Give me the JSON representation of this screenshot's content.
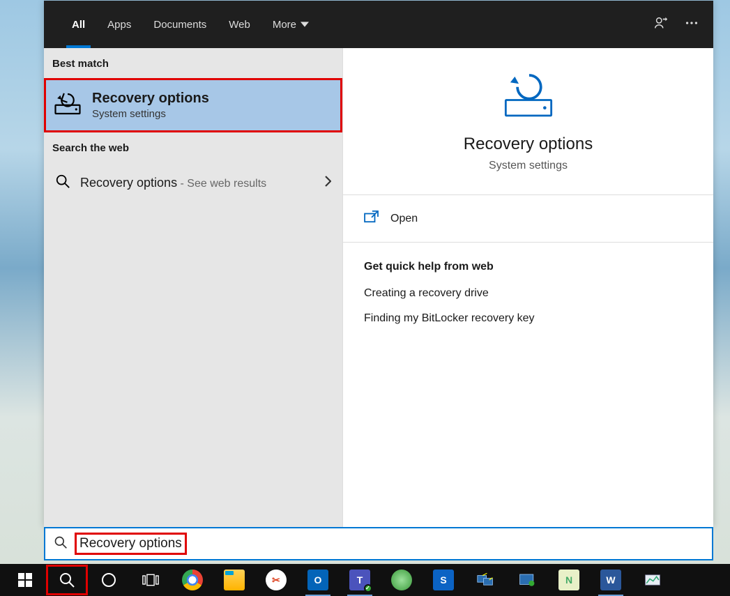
{
  "tabs": {
    "all": "All",
    "apps": "Apps",
    "documents": "Documents",
    "web": "Web",
    "more": "More"
  },
  "left": {
    "best_match_header": "Best match",
    "best_match_title": "Recovery options",
    "best_match_sub": "System settings",
    "search_web_header": "Search the web",
    "web_query": "Recovery options",
    "web_suffix": " - See web results"
  },
  "right": {
    "hero_title": "Recovery options",
    "hero_sub": "System settings",
    "open_label": "Open",
    "quick_help_header": "Get quick help from web",
    "links": {
      "0": "Creating a recovery drive",
      "1": "Finding my BitLocker recovery key"
    }
  },
  "searchbox": {
    "value": "Recovery options"
  },
  "taskbar": {
    "items": {
      "chrome": "Chrome",
      "explorer": "File Explorer",
      "snip": "Snip",
      "outlook": "Outlook",
      "teams": "Teams",
      "globe": "Browser",
      "shield": "Security",
      "rdp": "Remote Desktop",
      "rdp2": "Remote App",
      "np": "Notepad++",
      "word": "Word",
      "perf": "Performance"
    }
  }
}
